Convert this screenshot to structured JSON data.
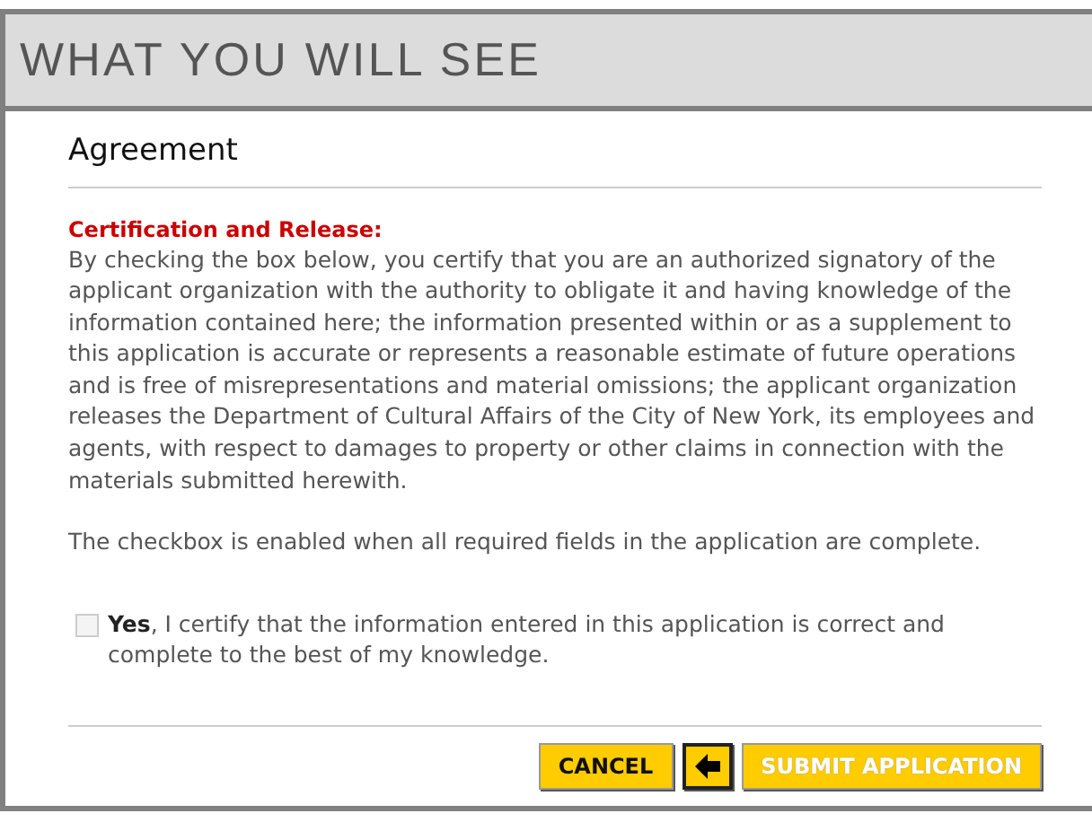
{
  "header": {
    "title": "WHAT YOU WILL SEE"
  },
  "section": {
    "title": "Agreement"
  },
  "certification": {
    "heading": "Certification and Release:",
    "text": "By checking the box below, you certify that you are an authorized signatory of the applicant organization with the authority to obligate it and having knowledge of the information contained here; the information presented within or as a supplement to this application is accurate or represents a reasonable estimate of future operations and is free of misrepresentations and material omissions; the applicant organization releases the Department of Cultural Affairs of the City of New York, its employees and agents, with respect to damages to property or other claims in connection with the materials submitted herewith.",
    "note": "The checkbox is enabled when all required fields in the application are complete."
  },
  "agreement_checkbox": {
    "label": "**Yes**, I certify that the information entered in this application is correct and complete to the best of my knowledge.",
    "checked": false,
    "disabled": true
  },
  "buttons": [
    {
      "kind": "text",
      "label": "CANCEL",
      "disabled": false
    },
    {
      "kind": "back",
      "disabled": false
    },
    {
      "kind": "text",
      "label": "SUBMIT APPLICATION",
      "disabled": true
    }
  ]
}
